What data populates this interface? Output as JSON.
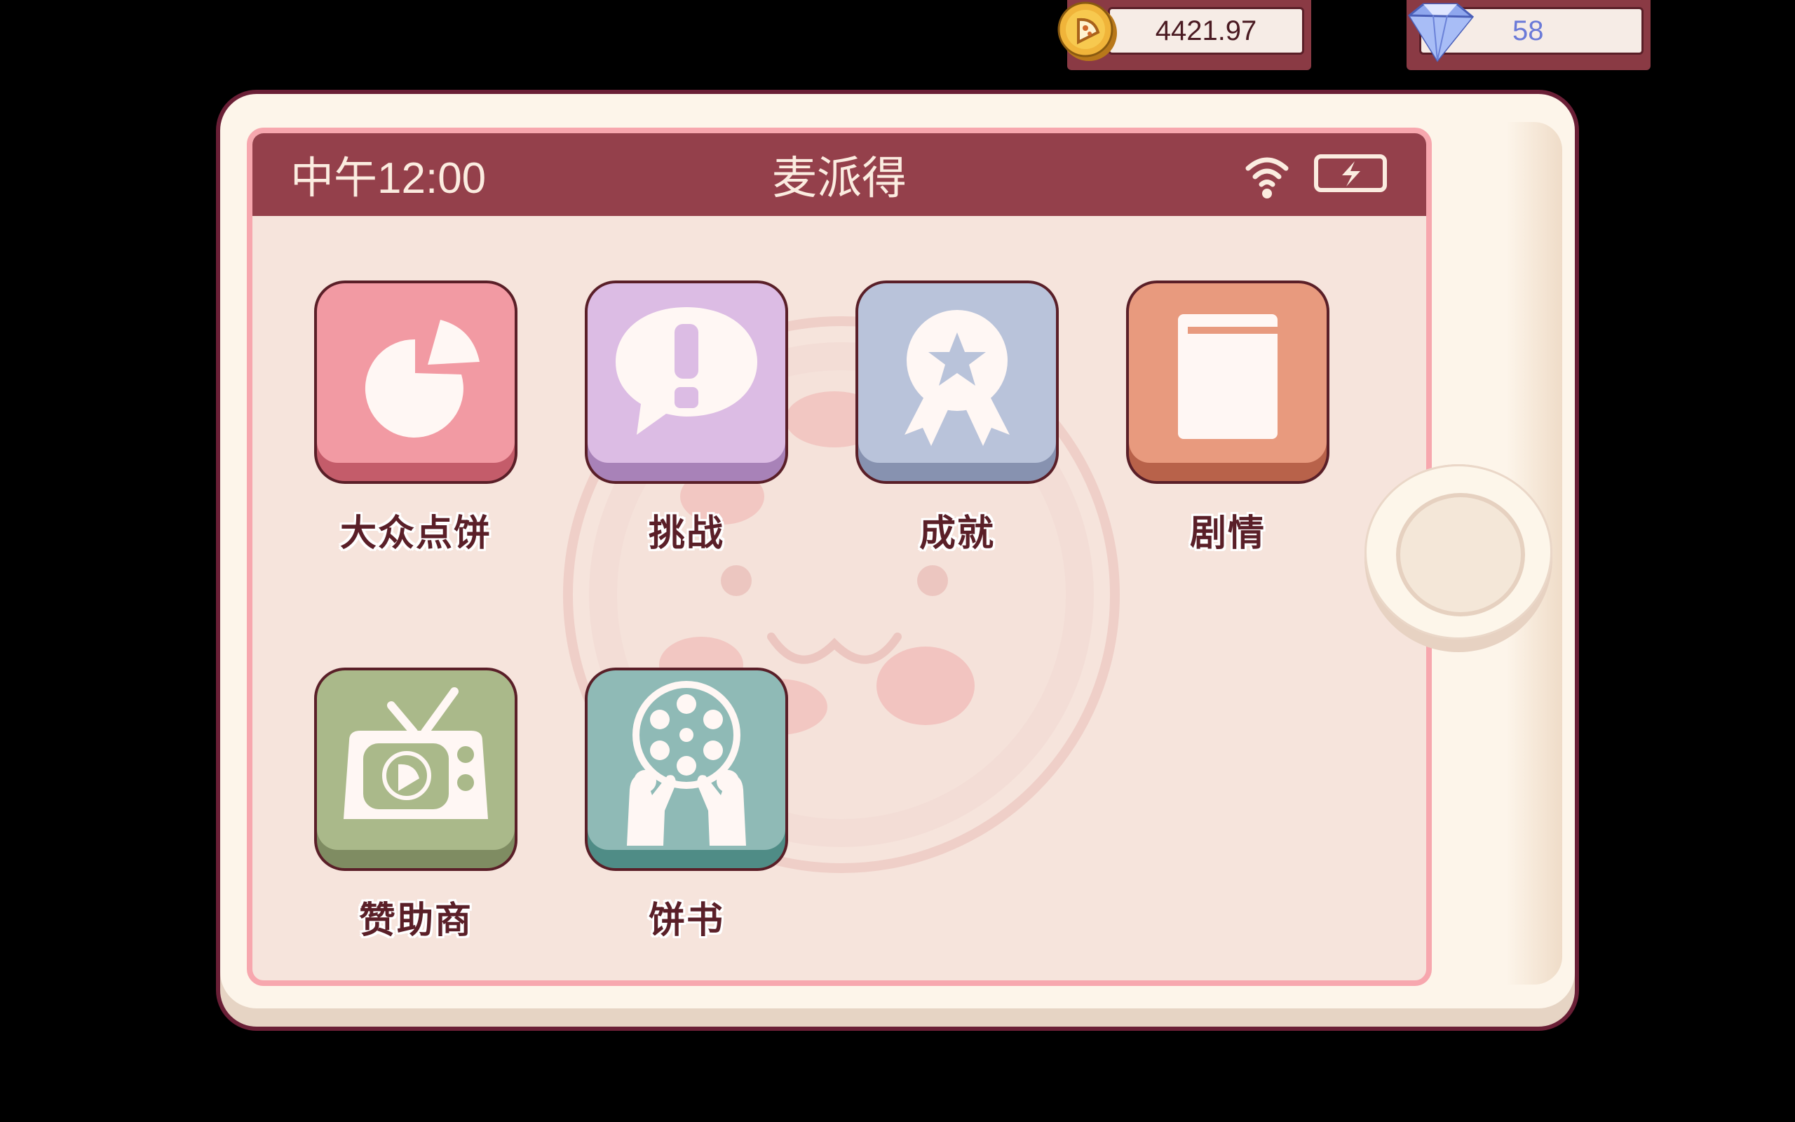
{
  "currency": {
    "coins": "4421.97",
    "gems": "58",
    "coin_icon": "pizza-coin-icon",
    "gem_icon": "diamond-icon"
  },
  "phone": {
    "time": "中午12:00",
    "title": "麦派得",
    "status_icons": [
      "wifi-icon",
      "battery-charging-icon"
    ],
    "status_bar_color": "#94404b"
  },
  "apps": [
    {
      "label": "大众点饼",
      "icon": "pie-chart-icon",
      "color": "#f29aa3"
    },
    {
      "label": "挑战",
      "icon": "speech-bubble-exclamation-icon",
      "color": "#dcbce4"
    },
    {
      "label": "成就",
      "icon": "award-medal-star-icon",
      "color": "#b9c3da"
    },
    {
      "label": "剧情",
      "icon": "book-icon",
      "color": "#e89a7e"
    },
    {
      "label": "赞助商",
      "icon": "tv-icon",
      "color": "#aab98a"
    },
    {
      "label": "饼书",
      "icon": "film-reel-hands-icon",
      "color": "#8fbab6"
    }
  ]
}
